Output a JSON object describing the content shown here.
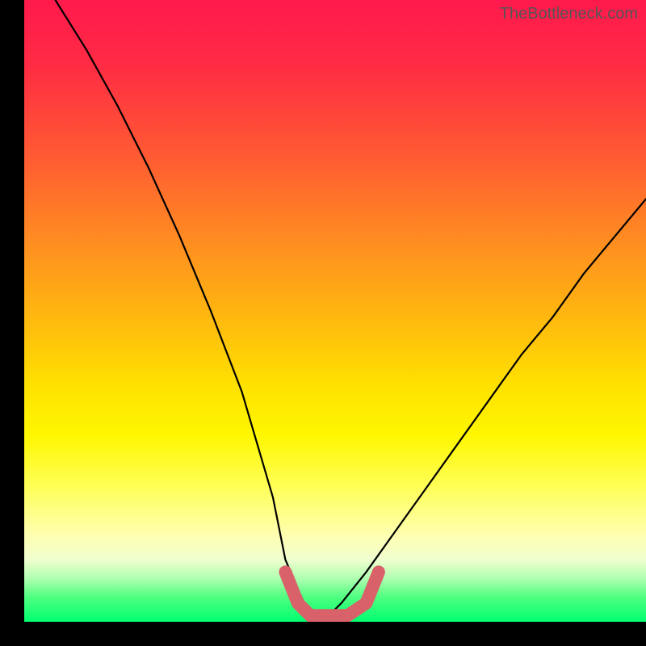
{
  "watermark": "TheBottleneck.com",
  "chart_data": {
    "type": "line",
    "title": "",
    "xlabel": "",
    "ylabel": "",
    "xlim": [
      0,
      100
    ],
    "ylim": [
      0,
      100
    ],
    "series": [
      {
        "name": "bottleneck-curve",
        "x": [
          5,
          10,
          15,
          20,
          25,
          30,
          35,
          40,
          42,
          45,
          47,
          49,
          51,
          55,
          60,
          65,
          70,
          75,
          80,
          85,
          90,
          95,
          100
        ],
        "y": [
          100,
          92,
          83,
          73,
          62,
          50,
          37,
          20,
          10,
          3,
          1,
          1,
          3,
          8,
          15,
          22,
          29,
          36,
          43,
          49,
          56,
          62,
          68
        ]
      }
    ],
    "annotations": [
      {
        "name": "trough-highlight",
        "type": "segment",
        "x": [
          42,
          44,
          46,
          49,
          52,
          55,
          57
        ],
        "y": [
          8,
          3,
          1,
          1,
          1,
          3,
          8
        ],
        "color": "#d9626a",
        "width": 16
      }
    ]
  }
}
